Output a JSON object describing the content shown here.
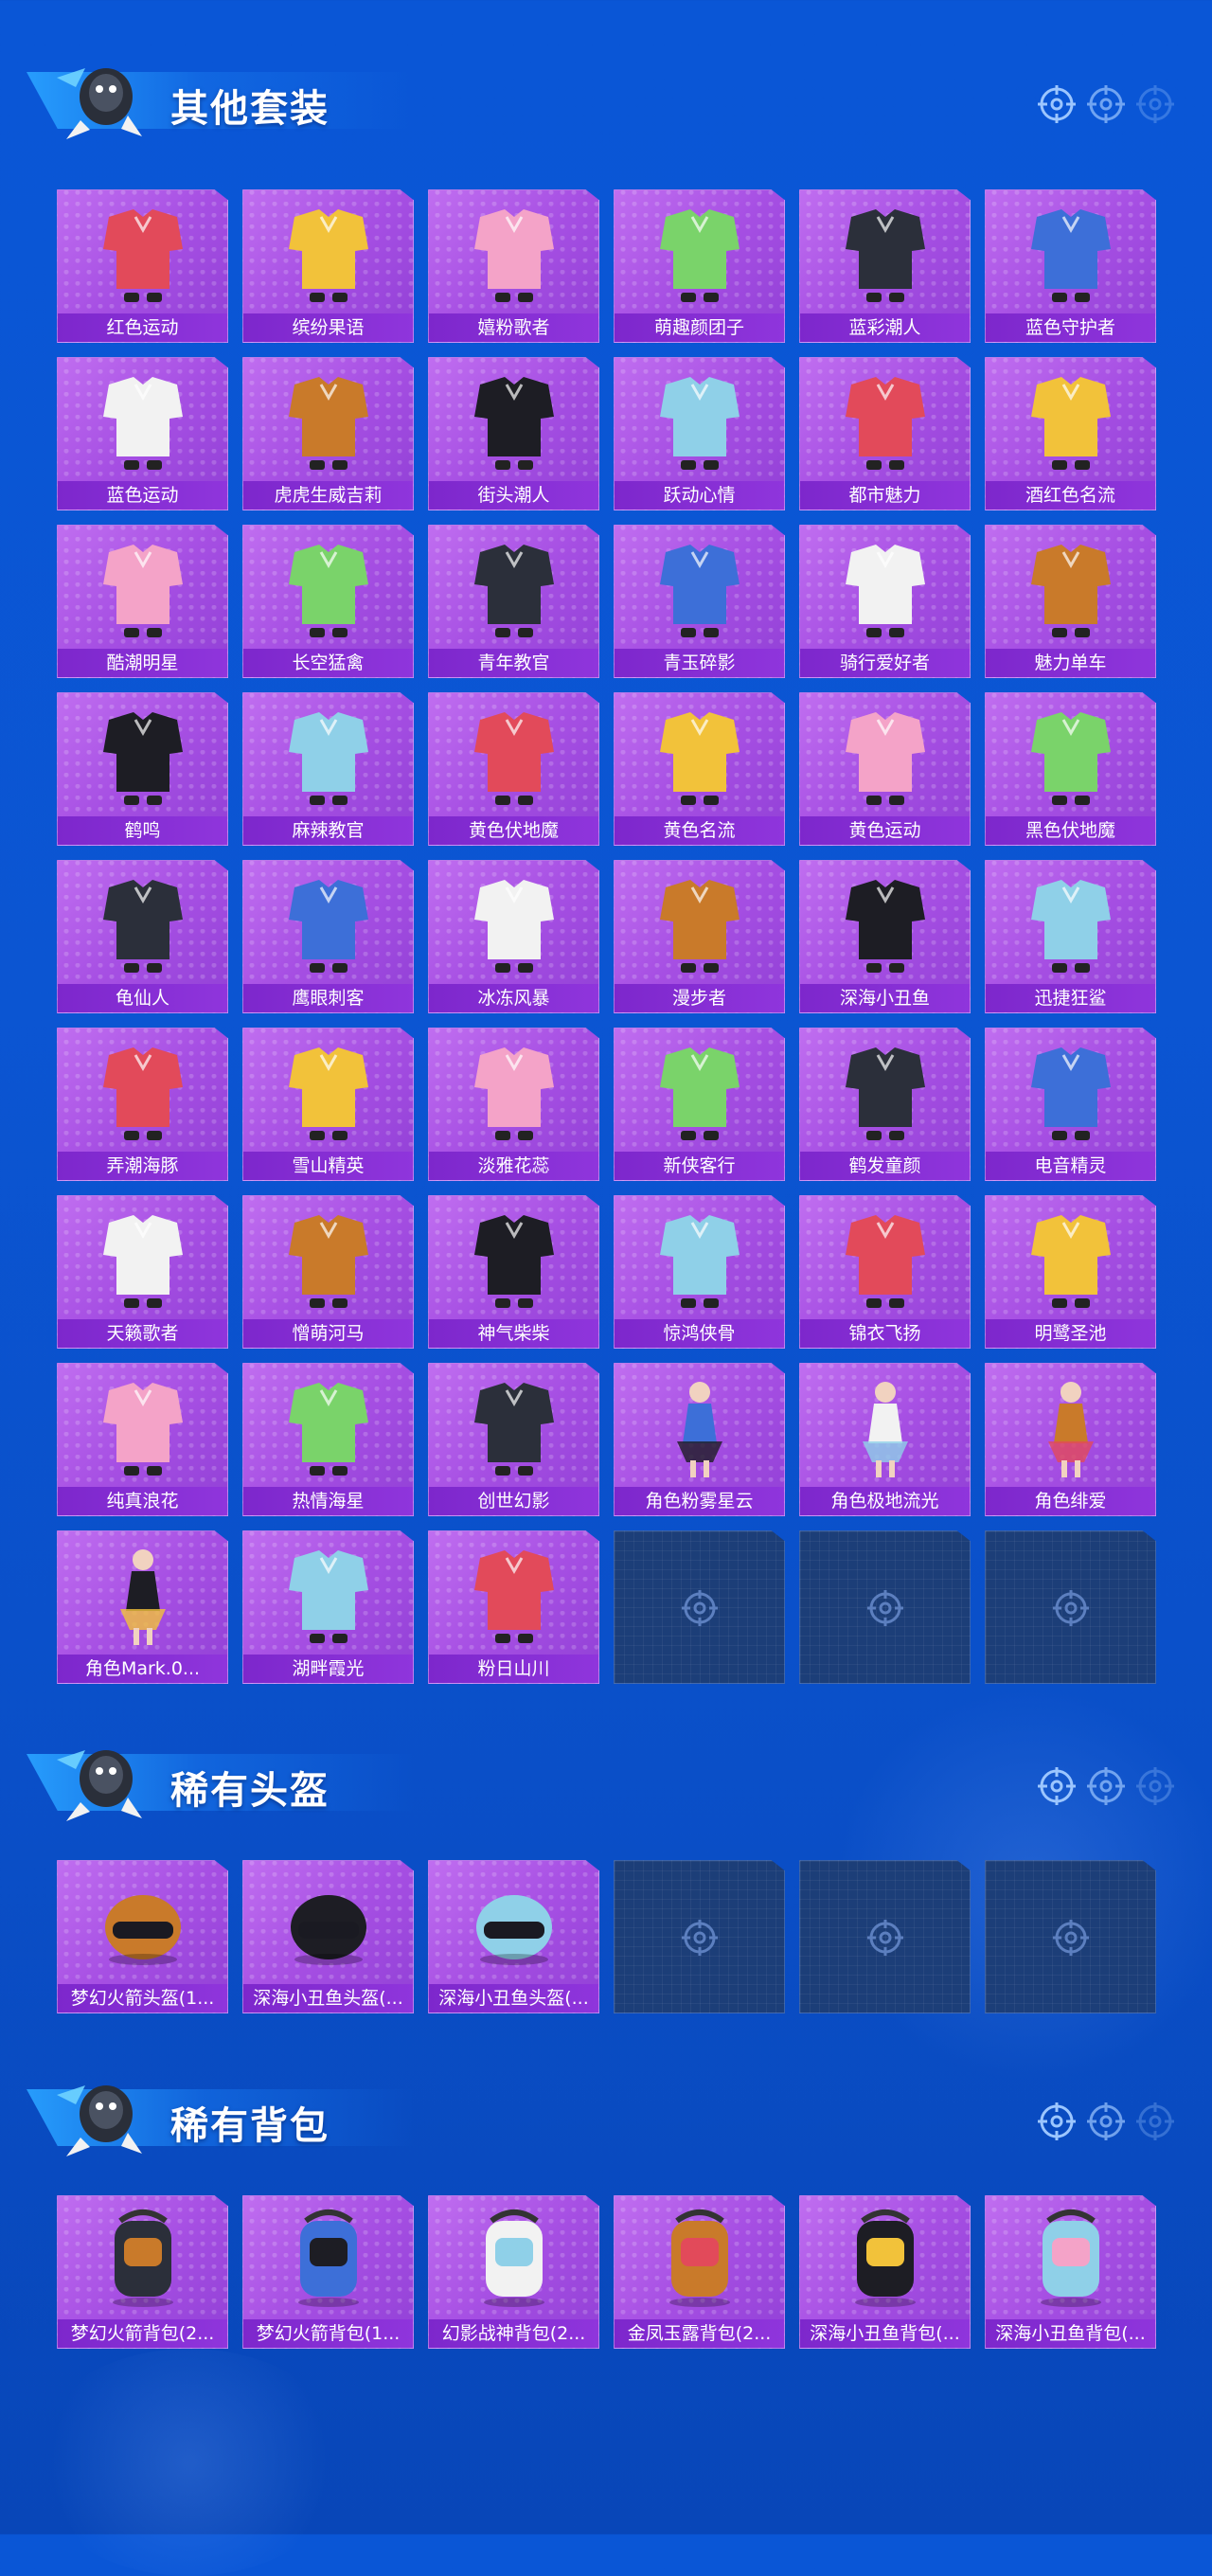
{
  "colors": {
    "background": "#0a56d6",
    "card": "#a64fe3",
    "card_label": "#7d27cc",
    "empty_slot": "#1c3e78"
  },
  "sections": [
    {
      "title": "其他套装",
      "items": [
        {
          "name": "红色运动",
          "icon": "outfit-icon"
        },
        {
          "name": "缤纷果语",
          "icon": "outfit-icon"
        },
        {
          "name": "嬉粉歌者",
          "icon": "outfit-icon"
        },
        {
          "name": "萌趣颜团子",
          "icon": "outfit-icon"
        },
        {
          "name": "蓝彩潮人",
          "icon": "outfit-icon"
        },
        {
          "name": "蓝色守护者",
          "icon": "outfit-icon"
        },
        {
          "name": "蓝色运动",
          "icon": "outfit-icon"
        },
        {
          "name": "虎虎生威吉莉",
          "icon": "outfit-icon"
        },
        {
          "name": "街头潮人",
          "icon": "outfit-icon"
        },
        {
          "name": "跃动心情",
          "icon": "outfit-icon"
        },
        {
          "name": "都市魅力",
          "icon": "outfit-icon"
        },
        {
          "name": "酒红色名流",
          "icon": "outfit-icon"
        },
        {
          "name": "酷潮明星",
          "icon": "outfit-icon"
        },
        {
          "name": "长空猛禽",
          "icon": "outfit-icon"
        },
        {
          "name": "青年教官",
          "icon": "outfit-icon"
        },
        {
          "name": "青玉碎影",
          "icon": "outfit-icon"
        },
        {
          "name": "骑行爱好者",
          "icon": "outfit-icon"
        },
        {
          "name": "魅力单车",
          "icon": "outfit-icon"
        },
        {
          "name": "鹤鸣",
          "icon": "outfit-icon"
        },
        {
          "name": "麻辣教官",
          "icon": "outfit-icon"
        },
        {
          "name": "黄色伏地魔",
          "icon": "outfit-icon"
        },
        {
          "name": "黄色名流",
          "icon": "outfit-icon"
        },
        {
          "name": "黄色运动",
          "icon": "outfit-icon"
        },
        {
          "name": "黑色伏地魔",
          "icon": "outfit-icon"
        },
        {
          "name": "龟仙人",
          "icon": "outfit-icon"
        },
        {
          "name": "鹰眼刺客",
          "icon": "outfit-icon"
        },
        {
          "name": "冰冻风暴",
          "icon": "outfit-icon"
        },
        {
          "name": "漫步者",
          "icon": "outfit-icon"
        },
        {
          "name": "深海小丑鱼",
          "icon": "outfit-icon"
        },
        {
          "name": "迅捷狂鲨",
          "icon": "outfit-icon"
        },
        {
          "name": "弄潮海豚",
          "icon": "outfit-icon"
        },
        {
          "name": "雪山精英",
          "icon": "outfit-icon"
        },
        {
          "name": "淡雅花蕊",
          "icon": "outfit-icon"
        },
        {
          "name": "新侠客行",
          "icon": "outfit-icon"
        },
        {
          "name": "鹤发童颜",
          "icon": "outfit-icon"
        },
        {
          "name": "电音精灵",
          "icon": "outfit-icon"
        },
        {
          "name": "天籁歌者",
          "icon": "outfit-icon"
        },
        {
          "name": "憎萌河马",
          "icon": "outfit-icon"
        },
        {
          "name": "神气柴柴",
          "icon": "outfit-icon"
        },
        {
          "name": "惊鸿侠骨",
          "icon": "outfit-icon"
        },
        {
          "name": "锦衣飞扬",
          "icon": "outfit-icon"
        },
        {
          "name": "明鹭圣池",
          "icon": "outfit-icon"
        },
        {
          "name": "纯真浪花",
          "icon": "outfit-icon"
        },
        {
          "name": "热情海星",
          "icon": "outfit-icon"
        },
        {
          "name": "创世幻影",
          "icon": "outfit-icon"
        },
        {
          "name": "角色粉雾星云",
          "icon": "character-icon"
        },
        {
          "name": "角色极地流光",
          "icon": "character-icon"
        },
        {
          "name": "角色绯爱",
          "icon": "character-icon"
        },
        {
          "name": "角色Mark.0...",
          "icon": "character-icon"
        },
        {
          "name": "湖畔霞光",
          "icon": "outfit-icon"
        },
        {
          "name": "粉日山川",
          "icon": "outfit-icon"
        }
      ],
      "empty_slots": 3
    },
    {
      "title": "稀有头盔",
      "items": [
        {
          "name": "梦幻火箭头盔(1...",
          "icon": "helmet-icon"
        },
        {
          "name": "深海小丑鱼头盔(...",
          "icon": "helmet-icon"
        },
        {
          "name": "深海小丑鱼头盔(...",
          "icon": "helmet-icon"
        }
      ],
      "empty_slots": 3
    },
    {
      "title": "稀有背包",
      "items": [
        {
          "name": "梦幻火箭背包(2...",
          "icon": "backpack-icon"
        },
        {
          "name": "梦幻火箭背包(1...",
          "icon": "backpack-icon"
        },
        {
          "name": "幻影战神背包(2...",
          "icon": "backpack-icon"
        },
        {
          "name": "金凤玉露背包(2...",
          "icon": "backpack-icon"
        },
        {
          "name": "深海小丑鱼背包(...",
          "icon": "backpack-icon"
        },
        {
          "name": "深海小丑鱼背包(...",
          "icon": "backpack-icon"
        }
      ],
      "empty_slots": 0
    }
  ]
}
